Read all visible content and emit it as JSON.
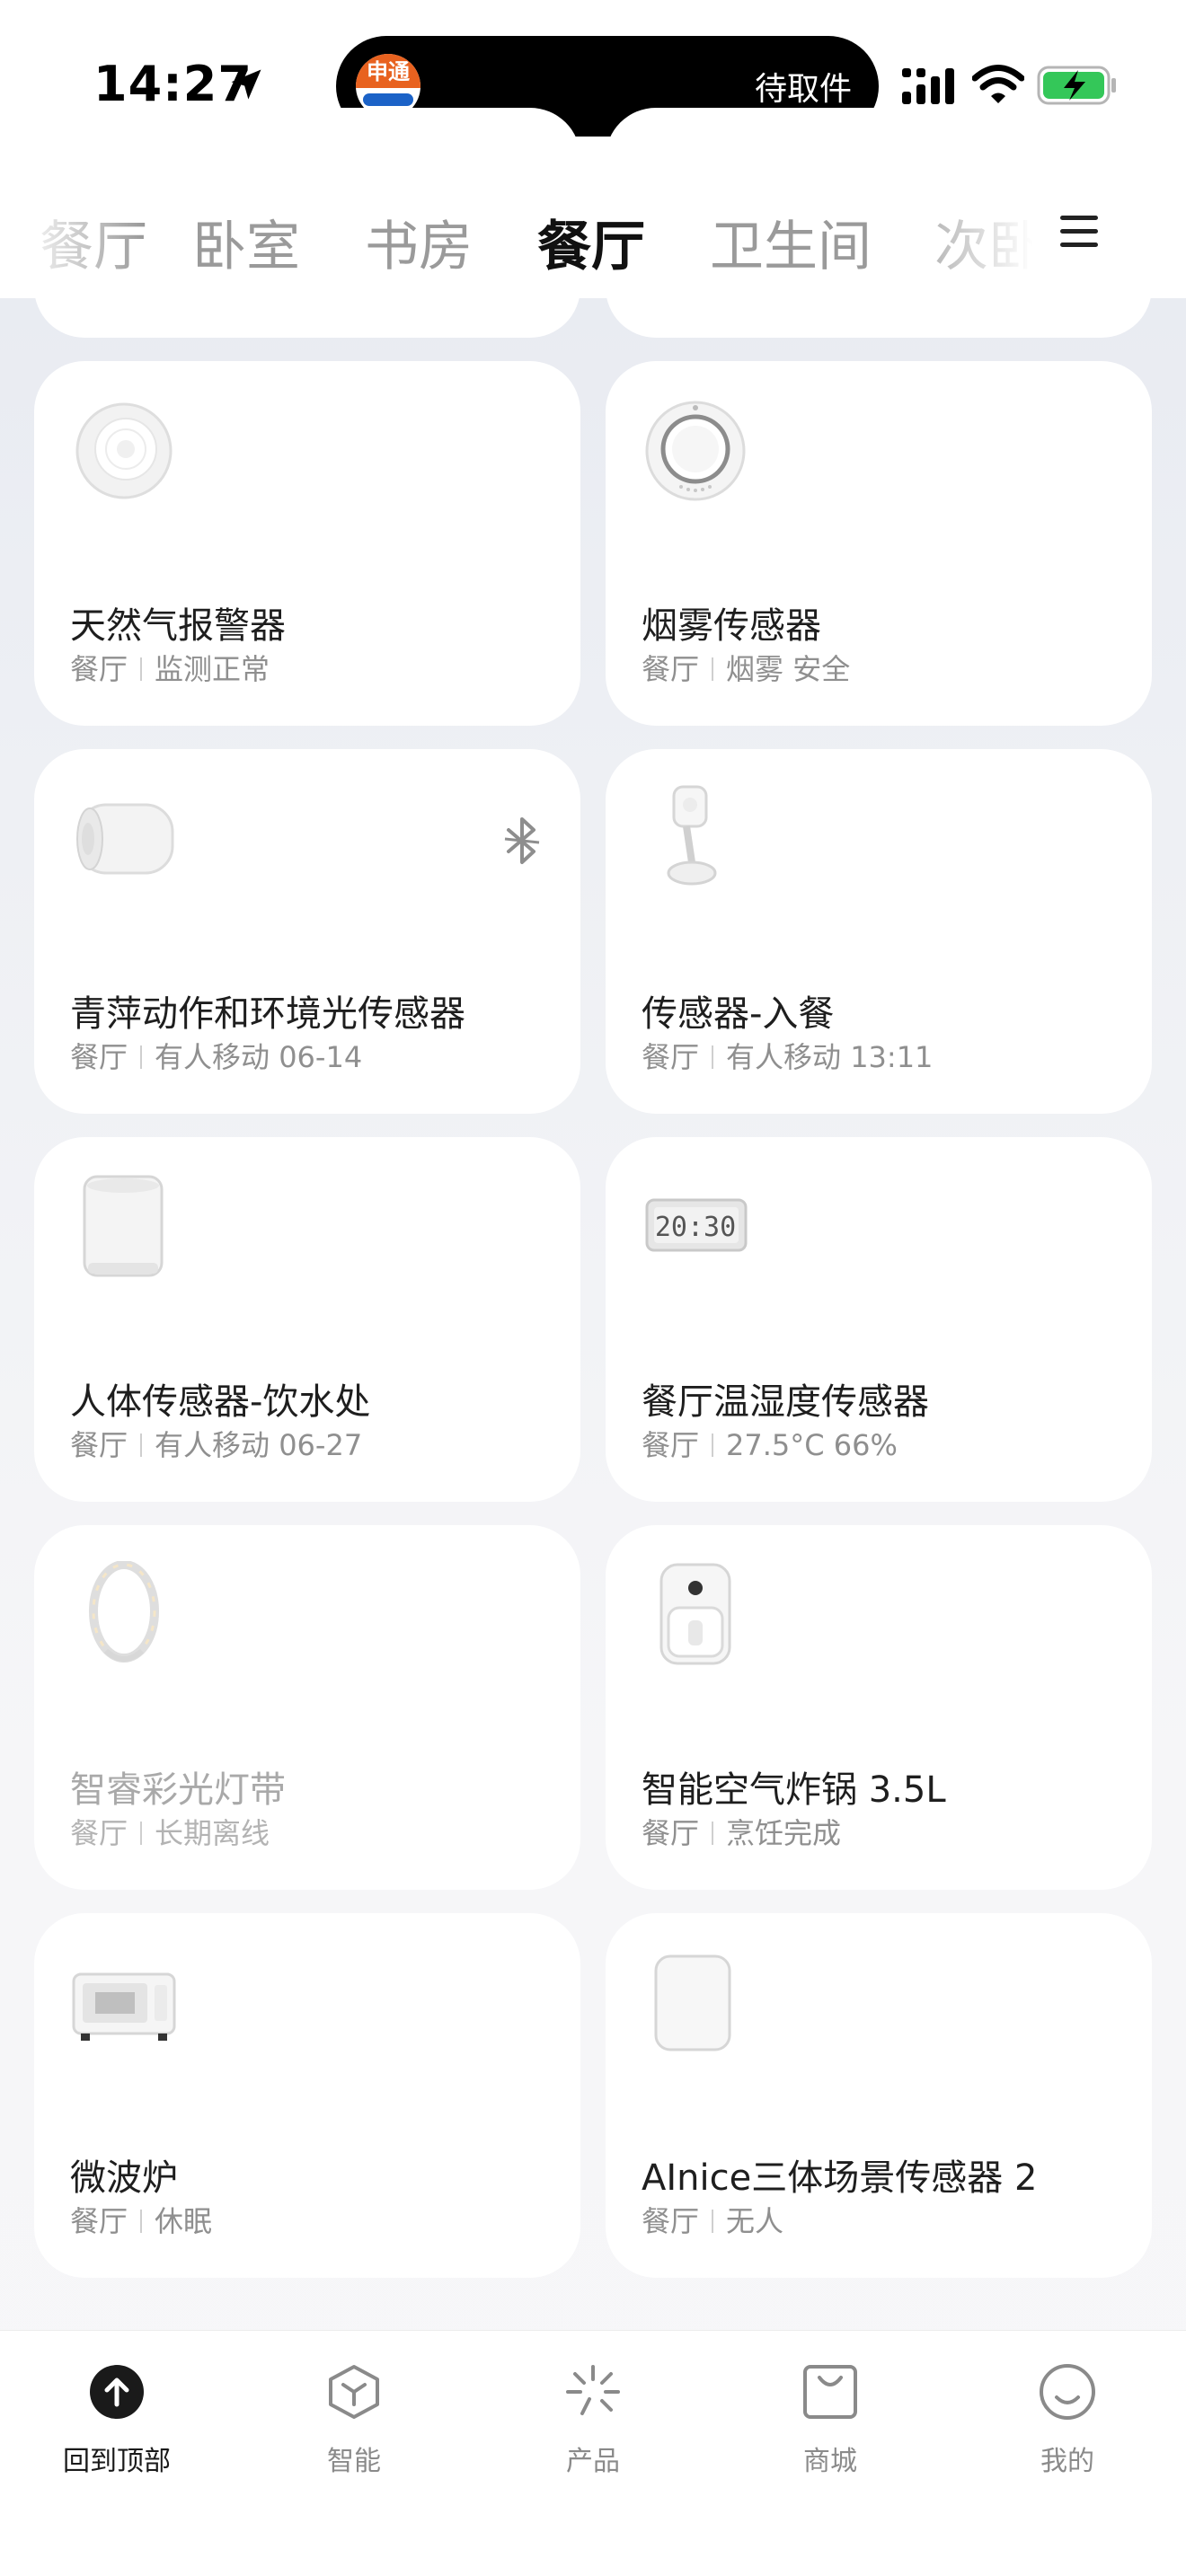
{
  "status_bar": {
    "time": "14:27",
    "island_logo_text": "申通",
    "island_text": "待取件"
  },
  "tabs": [
    "餐厅",
    "卧室",
    "书房",
    "餐厅",
    "卫生间",
    "次卧"
  ],
  "active_tab": "餐厅",
  "cards": [
    {
      "name": "天然气报警器",
      "room": "餐厅",
      "status": "监测正常",
      "icon": "gas-alarm-icon"
    },
    {
      "name": "烟雾传感器",
      "room": "餐厅",
      "status": "烟雾 安全",
      "icon": "smoke-sensor-icon"
    },
    {
      "name": "青萍动作和环境光传感器",
      "room": "餐厅",
      "status": "有人移动 06-14",
      "icon": "motion-light-sensor-icon",
      "bluetooth": true
    },
    {
      "name": "传感器-入餐",
      "room": "餐厅",
      "status": "有人移动 13:11",
      "icon": "motion-sensor-icon"
    },
    {
      "name": "人体传感器-饮水处",
      "room": "餐厅",
      "status": "有人移动 06-27",
      "icon": "body-sensor-icon"
    },
    {
      "name": "餐厅温湿度传感器",
      "room": "餐厅",
      "status": "27.5°C 66%",
      "icon": "thermo-hygrometer-icon",
      "display": "20:30"
    },
    {
      "name": "智睿彩光灯带",
      "room": "餐厅",
      "status": "长期离线",
      "icon": "light-strip-icon",
      "offline": true
    },
    {
      "name": "智能空气炸锅 3.5L",
      "room": "餐厅",
      "status": "烹饪完成",
      "icon": "air-fryer-icon"
    },
    {
      "name": "微波炉",
      "room": "餐厅",
      "status": "休眠",
      "icon": "microwave-icon"
    },
    {
      "name": "AInice三体场景传感器 2",
      "room": "餐厅",
      "status": "无人",
      "icon": "scene-sensor-icon"
    }
  ],
  "bottom_nav": [
    {
      "label": "回到顶部",
      "icon": "back-to-top-icon",
      "active": true
    },
    {
      "label": "智能",
      "icon": "smart-cube-icon"
    },
    {
      "label": "产品",
      "icon": "product-sparkle-icon"
    },
    {
      "label": "商城",
      "icon": "shopping-bag-icon"
    },
    {
      "label": "我的",
      "icon": "smiley-face-icon"
    }
  ]
}
